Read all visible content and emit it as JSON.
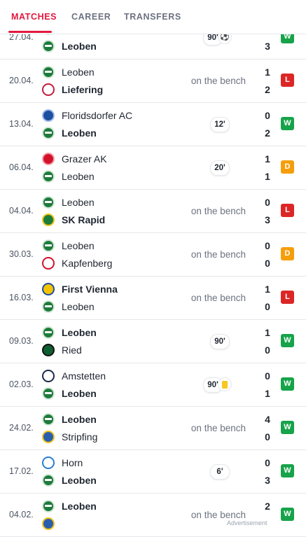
{
  "tabs": [
    {
      "label": "MATCHES",
      "active": true
    },
    {
      "label": "CAREER",
      "active": false
    },
    {
      "label": "TRANSFERS",
      "active": false
    }
  ],
  "matches": [
    {
      "date": "27.04.",
      "home": {
        "name": "",
        "crest": "leoben-crest",
        "bold": false
      },
      "away": {
        "name": "Leoben",
        "crest": "leoben-crest",
        "bold": true
      },
      "home_score": "",
      "away_score": "3",
      "minutes": "90'",
      "event_icon": "ball-icon",
      "bench": "",
      "result": "W"
    },
    {
      "date": "20.04.",
      "home": {
        "name": "Leoben",
        "crest": "leoben-crest",
        "bold": false
      },
      "away": {
        "name": "Liefering",
        "crest": "liefering-crest",
        "bold": true
      },
      "home_score": "1",
      "away_score": "2",
      "minutes": "",
      "event_icon": "",
      "bench": "on the bench",
      "result": "L"
    },
    {
      "date": "13.04.",
      "home": {
        "name": "Floridsdorfer AC",
        "crest": "fac-crest",
        "bold": false
      },
      "away": {
        "name": "Leoben",
        "crest": "leoben-crest",
        "bold": true
      },
      "home_score": "0",
      "away_score": "2",
      "minutes": "12'",
      "event_icon": "",
      "bench": "",
      "result": "W"
    },
    {
      "date": "06.04.",
      "home": {
        "name": "Grazer AK",
        "crest": "gak-crest",
        "bold": false
      },
      "away": {
        "name": "Leoben",
        "crest": "leoben-crest",
        "bold": false
      },
      "home_score": "1",
      "away_score": "1",
      "minutes": "20'",
      "event_icon": "",
      "bench": "",
      "result": "D"
    },
    {
      "date": "04.04.",
      "home": {
        "name": "Leoben",
        "crest": "leoben-crest",
        "bold": false
      },
      "away": {
        "name": "SK Rapid",
        "crest": "rapid-crest",
        "bold": true
      },
      "home_score": "0",
      "away_score": "3",
      "minutes": "",
      "event_icon": "",
      "bench": "on the bench",
      "result": "L"
    },
    {
      "date": "30.03.",
      "home": {
        "name": "Leoben",
        "crest": "leoben-crest",
        "bold": false
      },
      "away": {
        "name": "Kapfenberg",
        "crest": "kapfenberg-crest",
        "bold": false
      },
      "home_score": "0",
      "away_score": "0",
      "minutes": "",
      "event_icon": "",
      "bench": "on the bench",
      "result": "D"
    },
    {
      "date": "16.03.",
      "home": {
        "name": "First Vienna",
        "crest": "vienna-crest",
        "bold": true
      },
      "away": {
        "name": "Leoben",
        "crest": "leoben-crest",
        "bold": false
      },
      "home_score": "1",
      "away_score": "0",
      "minutes": "",
      "event_icon": "",
      "bench": "on the bench",
      "result": "L"
    },
    {
      "date": "09.03.",
      "home": {
        "name": "Leoben",
        "crest": "leoben-crest",
        "bold": true
      },
      "away": {
        "name": "Ried",
        "crest": "ried-crest",
        "bold": false
      },
      "home_score": "1",
      "away_score": "0",
      "minutes": "90'",
      "event_icon": "",
      "bench": "",
      "result": "W"
    },
    {
      "date": "02.03.",
      "home": {
        "name": "Amstetten",
        "crest": "amstetten-crest",
        "bold": false
      },
      "away": {
        "name": "Leoben",
        "crest": "leoben-crest",
        "bold": true
      },
      "home_score": "0",
      "away_score": "1",
      "minutes": "90'",
      "event_icon": "yellow-card-icon",
      "bench": "",
      "result": "W"
    },
    {
      "date": "24.02.",
      "home": {
        "name": "Leoben",
        "crest": "leoben-crest",
        "bold": true
      },
      "away": {
        "name": "Stripfing",
        "crest": "stripfing-crest",
        "bold": false
      },
      "home_score": "4",
      "away_score": "0",
      "minutes": "",
      "event_icon": "",
      "bench": "on the bench",
      "result": "W"
    },
    {
      "date": "17.02.",
      "home": {
        "name": "Horn",
        "crest": "horn-crest",
        "bold": false
      },
      "away": {
        "name": "Leoben",
        "crest": "leoben-crest",
        "bold": true
      },
      "home_score": "0",
      "away_score": "3",
      "minutes": "6'",
      "event_icon": "",
      "bench": "",
      "result": "W"
    },
    {
      "date": "04.02.",
      "home": {
        "name": "Leoben",
        "crest": "leoben-crest",
        "bold": true
      },
      "away": {
        "name": "",
        "crest": "stripfing-crest",
        "bold": false
      },
      "home_score": "2",
      "away_score": "",
      "minutes": "",
      "event_icon": "",
      "bench": "on the bench",
      "result": "W"
    }
  ],
  "ad_label": "Advertisement",
  "colors": {
    "accent": "#e3173e",
    "win": "#17a34a",
    "loss": "#dc2626",
    "draw": "#f59e0b"
  }
}
